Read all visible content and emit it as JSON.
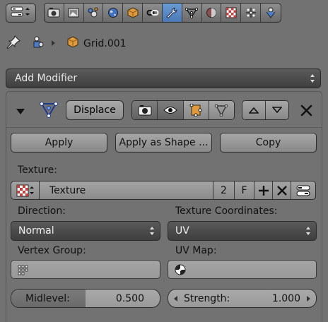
{
  "toolbar": {
    "editor_icon": "properties-editor-icon",
    "tabs": [
      {
        "icon": "render-icon",
        "active": false
      },
      {
        "icon": "render-layers-icon",
        "active": false
      },
      {
        "icon": "scene-icon",
        "active": false
      },
      {
        "icon": "world-icon",
        "active": false
      },
      {
        "icon": "object-icon",
        "active": false
      },
      {
        "icon": "constraints-icon",
        "active": false
      },
      {
        "icon": "modifiers-wrench-icon",
        "active": true
      },
      {
        "icon": "object-data-icon",
        "active": false
      },
      {
        "icon": "material-icon",
        "active": false
      },
      {
        "icon": "texture-icon",
        "active": false
      },
      {
        "icon": "particles-icon",
        "active": false
      },
      {
        "icon": "physics-icon",
        "active": false
      }
    ]
  },
  "breadcrumb": {
    "object_name": "Grid.001"
  },
  "add_modifier": {
    "label": "Add Modifier"
  },
  "modifier": {
    "name": "Displace",
    "apply_label": "Apply",
    "apply_shape_label": "Apply as Shape ...",
    "copy_label": "Copy",
    "texture_label": "Texture:",
    "texture_name": "Texture",
    "texture_users": "2",
    "texture_fake": "F",
    "direction_label": "Direction:",
    "direction_value": "Normal",
    "tex_coords_label": "Texture Coordinates:",
    "tex_coords_value": "UV",
    "vertex_group_label": "Vertex Group:",
    "vertex_group_value": "",
    "uv_map_label": "UV Map:",
    "uv_map_value": "",
    "midlevel_label": "Midlevel:",
    "midlevel_value": "0.500",
    "midlevel_fraction": 0.5,
    "strength_label": "Strength:",
    "strength_value": "1.000"
  },
  "colors": {
    "background": "#727272",
    "active_tab": "#5680c2",
    "dropdown": "#4a4a4a"
  }
}
